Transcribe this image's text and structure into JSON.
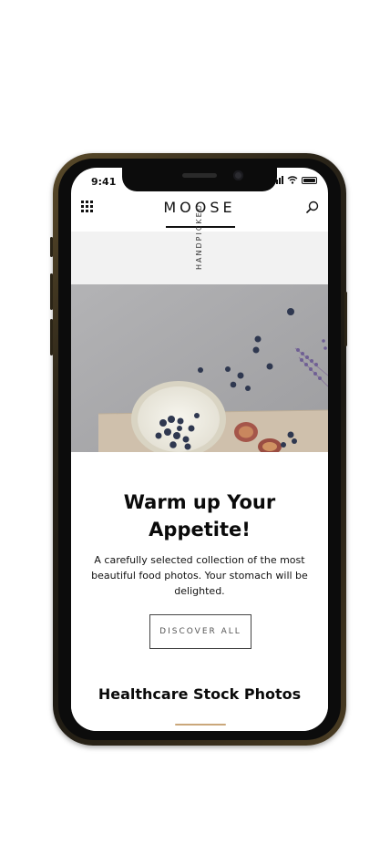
{
  "status_bar": {
    "time": "9:41"
  },
  "app": {
    "brand": "MOOSE"
  },
  "hero": {
    "vertical_label": "HANDPICKED"
  },
  "content": {
    "title": "Warm up Your Appetite!",
    "description": "A carefully selected collection of the most beautiful food photos. Your stomach will be delighted.",
    "cta_label": "DISCOVER ALL",
    "section_title": "Healthcare Stock Photos"
  },
  "colors": {
    "phone_frame": "#1b1812",
    "accent": "#caa77a"
  }
}
